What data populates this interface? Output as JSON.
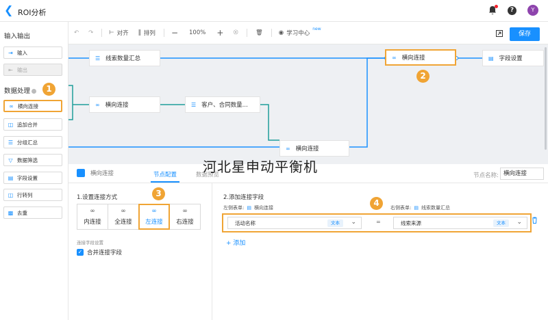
{
  "header": {
    "title": "ROI分析"
  },
  "user": {
    "avatar_letter": "Y"
  },
  "leftpanel": {
    "io_section": "输入输出",
    "io_items": [
      {
        "label": "输入",
        "icon": "login-arrow-icon",
        "disabled": false
      },
      {
        "label": "输出",
        "icon": "logout-arrow-icon",
        "disabled": true
      }
    ],
    "process_section": "数据处理",
    "process_items": [
      {
        "label": "横向连接",
        "icon": "link-icon"
      },
      {
        "label": "追加合并",
        "icon": "append-icon"
      },
      {
        "label": "分组汇总",
        "icon": "group-icon"
      },
      {
        "label": "数据筛选",
        "icon": "filter-icon"
      },
      {
        "label": "字段设置",
        "icon": "field-settings-icon"
      },
      {
        "label": "行转列",
        "icon": "pivot-icon"
      },
      {
        "label": "去重",
        "icon": "dedupe-icon"
      }
    ]
  },
  "toolbar": {
    "align": "对齐",
    "arrange": "排列",
    "zoom": "100%",
    "learn": "学习中心",
    "learn_tag": "new",
    "save": "保存"
  },
  "canvas": {
    "nodes": {
      "n1": "线索数量汇总",
      "n2": "横向连接",
      "n3": "客户、合同数量...",
      "n4": "横向连接",
      "n5": "横向连接",
      "n6": "字段设置"
    }
  },
  "badges": [
    "1",
    "2",
    "3",
    "4"
  ],
  "config": {
    "node_chip": "横向连接",
    "tab_active": "节点配置",
    "tab_other": "数据预览",
    "node_name_label": "节点名称:",
    "node_name_value": "横向连接",
    "section1": "1.设置连接方式",
    "join_types": [
      "内连接",
      "全连接",
      "左连接",
      "右连接"
    ],
    "join_selected": "左连接",
    "join_field_settings": "连接字段设置",
    "merge_fields": "合并连接字段",
    "section2": "2.添加连接字段",
    "left_table_label": "左侧表单:",
    "left_table": "横向连接",
    "right_table_label": "右侧表单:",
    "right_table": "线索数量汇总",
    "left_field": "活动名称",
    "left_type": "文本",
    "equals": "=",
    "right_field": "线索来源",
    "right_type": "文本",
    "add": "添加"
  },
  "watermark": "河北星申动平衡机",
  "colors": {
    "accent": "#1890ff",
    "highlight": "#f0a434",
    "wire": "#1e9e9a"
  }
}
